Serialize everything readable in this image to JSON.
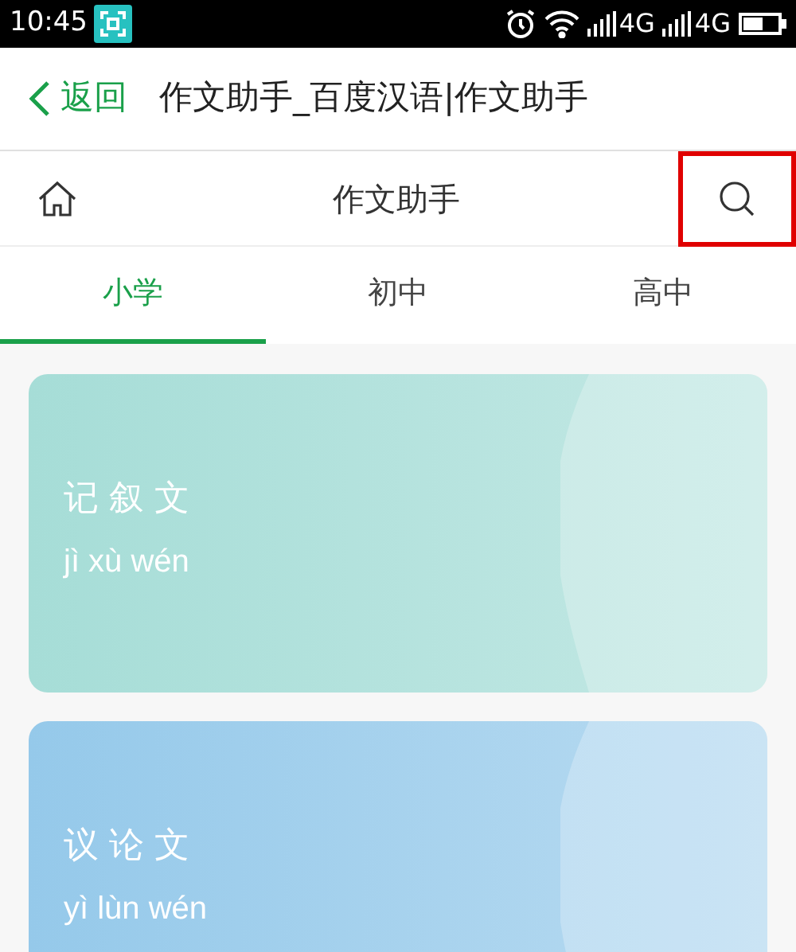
{
  "status_bar": {
    "time": "10:45",
    "network_1": "4G",
    "network_2": "4G"
  },
  "nav_bar": {
    "back_label": "返回",
    "title": "作文助手_百度汉语|作文助手"
  },
  "header": {
    "title": "作文助手",
    "search_highlighted": true
  },
  "tabs": [
    {
      "label": "小学",
      "selected": true
    },
    {
      "label": "初中",
      "selected": false
    },
    {
      "label": "高中",
      "selected": false
    }
  ],
  "cards": [
    {
      "title": "记叙文",
      "pinyin": "jì xù wén",
      "color": "#a6ddd7"
    },
    {
      "title": "议论文",
      "pinyin": "yì lùn wén",
      "color": "#95c9ea"
    }
  ]
}
